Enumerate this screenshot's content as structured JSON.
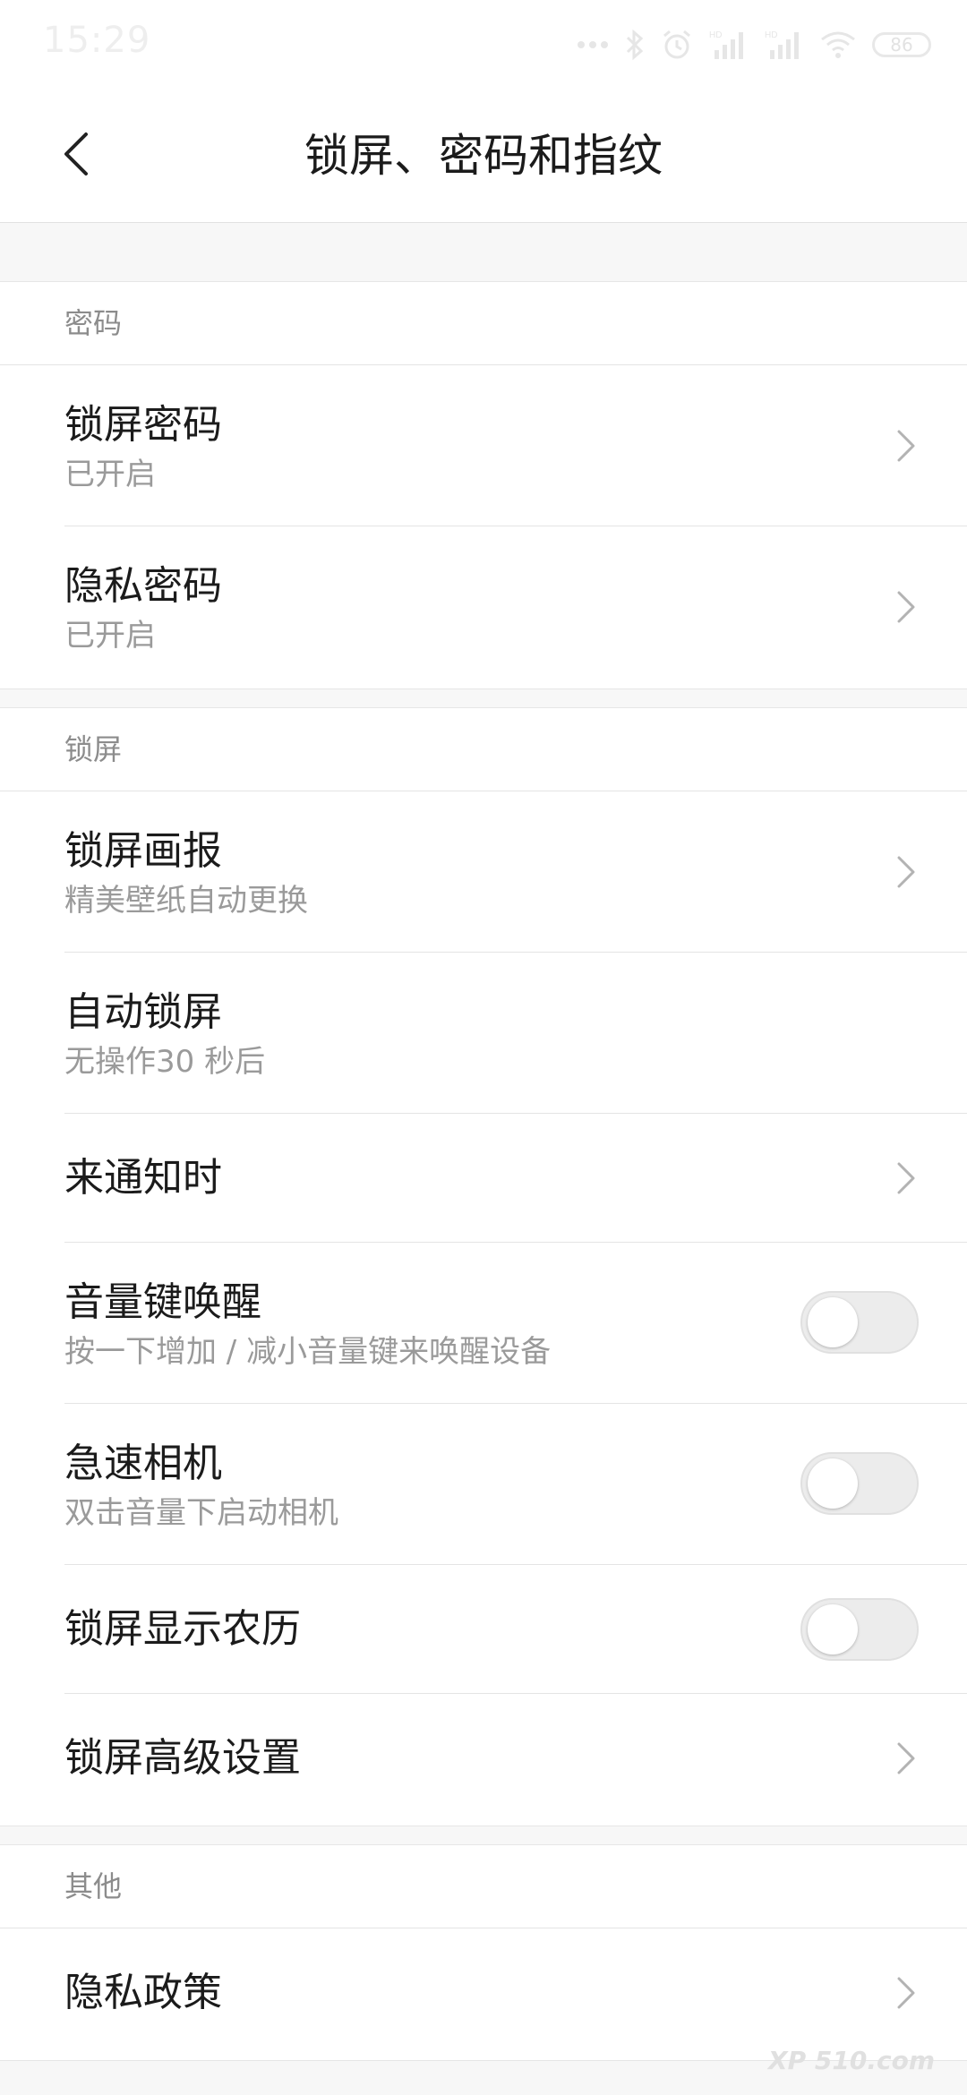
{
  "status_bar": {
    "time": "15:29",
    "battery": "86",
    "icons": [
      "more-dots-icon",
      "bluetooth-icon",
      "alarm-icon",
      "signal-hd-icon",
      "signal-hd-icon",
      "wifi-icon",
      "battery-icon"
    ]
  },
  "header": {
    "title": "锁屏、密码和指纹",
    "back_icon": "back-arrow-icon"
  },
  "sections": {
    "password": {
      "title": "密码",
      "items": [
        {
          "label": "锁屏密码",
          "sub": "已开启",
          "control": "chevron"
        },
        {
          "label": "隐私密码",
          "sub": "已开启",
          "control": "chevron"
        }
      ]
    },
    "lockscreen": {
      "title": "锁屏",
      "items": [
        {
          "label": "锁屏画报",
          "sub": "精美壁纸自动更换",
          "control": "chevron"
        },
        {
          "label": "自动锁屏",
          "sub": "无操作30 秒后",
          "control": "none"
        },
        {
          "label": "来通知时",
          "control": "chevron"
        },
        {
          "label": "音量键唤醒",
          "sub": "按一下增加 / 减小音量键来唤醒设备",
          "control": "toggle",
          "checked": false
        },
        {
          "label": "急速相机",
          "sub": "双击音量下启动相机",
          "control": "toggle",
          "checked": false
        },
        {
          "label": "锁屏显示农历",
          "control": "toggle",
          "checked": false
        },
        {
          "label": "锁屏高级设置",
          "control": "chevron"
        }
      ]
    },
    "other": {
      "title": "其他",
      "items": [
        {
          "label": "隐私政策",
          "control": "chevron"
        }
      ]
    }
  },
  "watermark": "XP 510.com",
  "colors": {
    "background": "#f7f7f7",
    "surface": "#ffffff",
    "text_primary": "#1b1b1b",
    "text_secondary": "#9a9a9a",
    "section_title": "#8c8c8c",
    "toggle_off": "#ececec"
  }
}
